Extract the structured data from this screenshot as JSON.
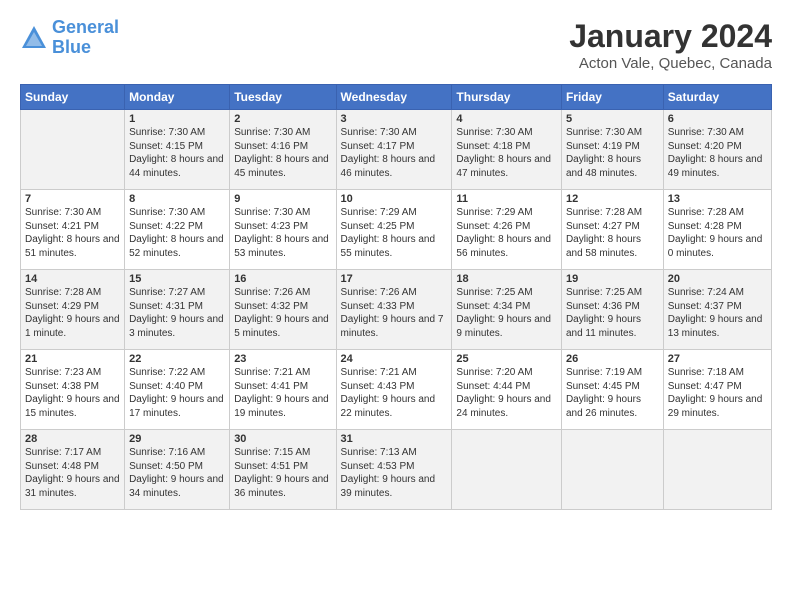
{
  "header": {
    "logo_line1": "General",
    "logo_line2": "Blue",
    "title": "January 2024",
    "subtitle": "Acton Vale, Quebec, Canada"
  },
  "days_of_week": [
    "Sunday",
    "Monday",
    "Tuesday",
    "Wednesday",
    "Thursday",
    "Friday",
    "Saturday"
  ],
  "weeks": [
    [
      {
        "day": "",
        "sunrise": "",
        "sunset": "",
        "daylight": ""
      },
      {
        "day": "1",
        "sunrise": "Sunrise: 7:30 AM",
        "sunset": "Sunset: 4:15 PM",
        "daylight": "Daylight: 8 hours and 44 minutes."
      },
      {
        "day": "2",
        "sunrise": "Sunrise: 7:30 AM",
        "sunset": "Sunset: 4:16 PM",
        "daylight": "Daylight: 8 hours and 45 minutes."
      },
      {
        "day": "3",
        "sunrise": "Sunrise: 7:30 AM",
        "sunset": "Sunset: 4:17 PM",
        "daylight": "Daylight: 8 hours and 46 minutes."
      },
      {
        "day": "4",
        "sunrise": "Sunrise: 7:30 AM",
        "sunset": "Sunset: 4:18 PM",
        "daylight": "Daylight: 8 hours and 47 minutes."
      },
      {
        "day": "5",
        "sunrise": "Sunrise: 7:30 AM",
        "sunset": "Sunset: 4:19 PM",
        "daylight": "Daylight: 8 hours and 48 minutes."
      },
      {
        "day": "6",
        "sunrise": "Sunrise: 7:30 AM",
        "sunset": "Sunset: 4:20 PM",
        "daylight": "Daylight: 8 hours and 49 minutes."
      }
    ],
    [
      {
        "day": "7",
        "sunrise": "Sunrise: 7:30 AM",
        "sunset": "Sunset: 4:21 PM",
        "daylight": "Daylight: 8 hours and 51 minutes."
      },
      {
        "day": "8",
        "sunrise": "Sunrise: 7:30 AM",
        "sunset": "Sunset: 4:22 PM",
        "daylight": "Daylight: 8 hours and 52 minutes."
      },
      {
        "day": "9",
        "sunrise": "Sunrise: 7:30 AM",
        "sunset": "Sunset: 4:23 PM",
        "daylight": "Daylight: 8 hours and 53 minutes."
      },
      {
        "day": "10",
        "sunrise": "Sunrise: 7:29 AM",
        "sunset": "Sunset: 4:25 PM",
        "daylight": "Daylight: 8 hours and 55 minutes."
      },
      {
        "day": "11",
        "sunrise": "Sunrise: 7:29 AM",
        "sunset": "Sunset: 4:26 PM",
        "daylight": "Daylight: 8 hours and 56 minutes."
      },
      {
        "day": "12",
        "sunrise": "Sunrise: 7:28 AM",
        "sunset": "Sunset: 4:27 PM",
        "daylight": "Daylight: 8 hours and 58 minutes."
      },
      {
        "day": "13",
        "sunrise": "Sunrise: 7:28 AM",
        "sunset": "Sunset: 4:28 PM",
        "daylight": "Daylight: 9 hours and 0 minutes."
      }
    ],
    [
      {
        "day": "14",
        "sunrise": "Sunrise: 7:28 AM",
        "sunset": "Sunset: 4:29 PM",
        "daylight": "Daylight: 9 hours and 1 minute."
      },
      {
        "day": "15",
        "sunrise": "Sunrise: 7:27 AM",
        "sunset": "Sunset: 4:31 PM",
        "daylight": "Daylight: 9 hours and 3 minutes."
      },
      {
        "day": "16",
        "sunrise": "Sunrise: 7:26 AM",
        "sunset": "Sunset: 4:32 PM",
        "daylight": "Daylight: 9 hours and 5 minutes."
      },
      {
        "day": "17",
        "sunrise": "Sunrise: 7:26 AM",
        "sunset": "Sunset: 4:33 PM",
        "daylight": "Daylight: 9 hours and 7 minutes."
      },
      {
        "day": "18",
        "sunrise": "Sunrise: 7:25 AM",
        "sunset": "Sunset: 4:34 PM",
        "daylight": "Daylight: 9 hours and 9 minutes."
      },
      {
        "day": "19",
        "sunrise": "Sunrise: 7:25 AM",
        "sunset": "Sunset: 4:36 PM",
        "daylight": "Daylight: 9 hours and 11 minutes."
      },
      {
        "day": "20",
        "sunrise": "Sunrise: 7:24 AM",
        "sunset": "Sunset: 4:37 PM",
        "daylight": "Daylight: 9 hours and 13 minutes."
      }
    ],
    [
      {
        "day": "21",
        "sunrise": "Sunrise: 7:23 AM",
        "sunset": "Sunset: 4:38 PM",
        "daylight": "Daylight: 9 hours and 15 minutes."
      },
      {
        "day": "22",
        "sunrise": "Sunrise: 7:22 AM",
        "sunset": "Sunset: 4:40 PM",
        "daylight": "Daylight: 9 hours and 17 minutes."
      },
      {
        "day": "23",
        "sunrise": "Sunrise: 7:21 AM",
        "sunset": "Sunset: 4:41 PM",
        "daylight": "Daylight: 9 hours and 19 minutes."
      },
      {
        "day": "24",
        "sunrise": "Sunrise: 7:21 AM",
        "sunset": "Sunset: 4:43 PM",
        "daylight": "Daylight: 9 hours and 22 minutes."
      },
      {
        "day": "25",
        "sunrise": "Sunrise: 7:20 AM",
        "sunset": "Sunset: 4:44 PM",
        "daylight": "Daylight: 9 hours and 24 minutes."
      },
      {
        "day": "26",
        "sunrise": "Sunrise: 7:19 AM",
        "sunset": "Sunset: 4:45 PM",
        "daylight": "Daylight: 9 hours and 26 minutes."
      },
      {
        "day": "27",
        "sunrise": "Sunrise: 7:18 AM",
        "sunset": "Sunset: 4:47 PM",
        "daylight": "Daylight: 9 hours and 29 minutes."
      }
    ],
    [
      {
        "day": "28",
        "sunrise": "Sunrise: 7:17 AM",
        "sunset": "Sunset: 4:48 PM",
        "daylight": "Daylight: 9 hours and 31 minutes."
      },
      {
        "day": "29",
        "sunrise": "Sunrise: 7:16 AM",
        "sunset": "Sunset: 4:50 PM",
        "daylight": "Daylight: 9 hours and 34 minutes."
      },
      {
        "day": "30",
        "sunrise": "Sunrise: 7:15 AM",
        "sunset": "Sunset: 4:51 PM",
        "daylight": "Daylight: 9 hours and 36 minutes."
      },
      {
        "day": "31",
        "sunrise": "Sunrise: 7:13 AM",
        "sunset": "Sunset: 4:53 PM",
        "daylight": "Daylight: 9 hours and 39 minutes."
      },
      {
        "day": "",
        "sunrise": "",
        "sunset": "",
        "daylight": ""
      },
      {
        "day": "",
        "sunrise": "",
        "sunset": "",
        "daylight": ""
      },
      {
        "day": "",
        "sunrise": "",
        "sunset": "",
        "daylight": ""
      }
    ]
  ]
}
